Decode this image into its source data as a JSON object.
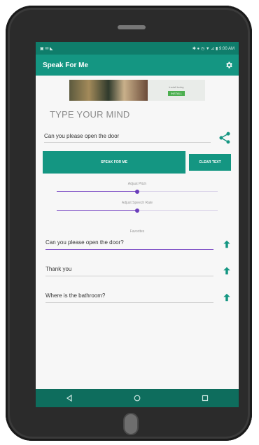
{
  "status_bar": {
    "left_icons": "▣ ✉ ◣",
    "right_text": "✱ ● ◷ ▼ ⊿ ▮ 9:00 AM"
  },
  "app": {
    "title": "Speak For Me",
    "settings_icon": "gear-icon"
  },
  "ad": {
    "line1": "Install today",
    "line2": "ad",
    "button": "INSTALL"
  },
  "heading": "TYPE YOUR MIND",
  "input": {
    "value": "Can you please open the door"
  },
  "buttons": {
    "speak": "SPEAK FOR ME",
    "clear": "CLEAR TEXT"
  },
  "sliders": {
    "pitch": {
      "label": "Adjust Pitch",
      "value": 0.5
    },
    "rate": {
      "label": "Adjust Speech Rate",
      "value": 0.5
    }
  },
  "favorites": {
    "label": "Favorites",
    "items": [
      {
        "text": "Can you please open the door?"
      },
      {
        "text": "Thank you"
      },
      {
        "text": "Where is the bathroom?"
      }
    ]
  },
  "colors": {
    "primary": "#149682",
    "primary_dark": "#0f7d6b",
    "accent": "#7b4bc4",
    "device": "#2b2b2b"
  }
}
